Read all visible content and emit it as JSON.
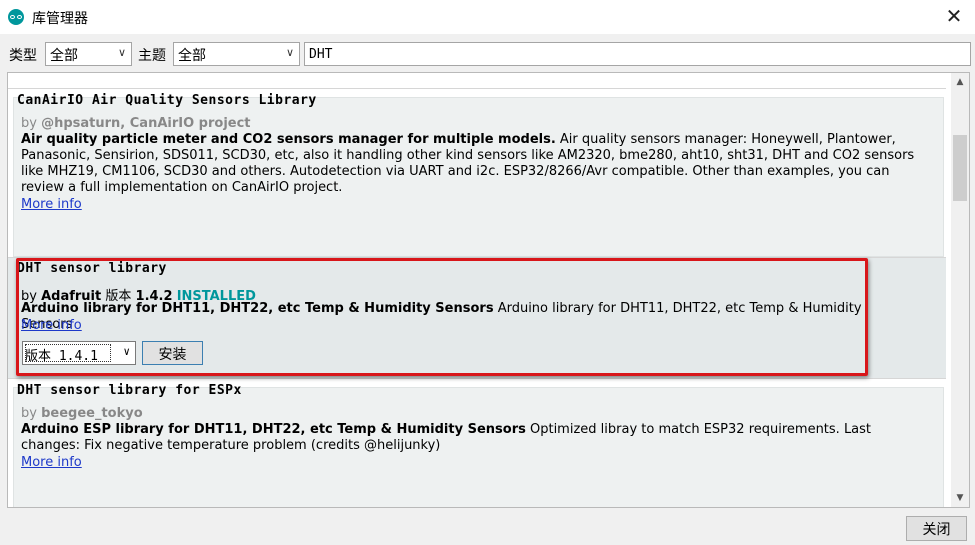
{
  "window": {
    "title": "库管理器",
    "close_glyph": "✕"
  },
  "filters": {
    "type_label": "类型",
    "type_value": "全部",
    "topic_label": "主题",
    "topic_value": "全部",
    "search_value": "DHT"
  },
  "libraries": [
    {
      "name": "CanAirIO Air Quality Sensors Library",
      "by_prefix": "by",
      "author": "@hpsaturn, CanAirIO project",
      "desc_bold": "Air quality particle meter and CO2 sensors manager for multiple models.",
      "desc": " Air quality sensors manager: Honeywell, Plantower, Panasonic, Sensirion, SDS011, SCD30, etc, also it handling other kind sensors like AM2320, bme280, aht10, sht31, DHT and CO2 sensors like MHZ19, CM1106, SCD30 and others. Autodetection via UART and i2c. ESP32/8266/Avr compatible. Other than examples, you can review a full implementation on CanAirIO project.",
      "more_info": "More info"
    },
    {
      "name": "DHT sensor library",
      "by_prefix": "by",
      "author": "Adafruit",
      "version_label": "版本",
      "version": "1.4.2",
      "status": "INSTALLED",
      "desc_bold": "Arduino library for DHT11, DHT22, etc Temp & Humidity Sensors",
      "desc": " Arduino library for DHT11, DHT22, etc Temp & Humidity Sensors",
      "more_info": "More info",
      "version_select": "版本 1.4.1",
      "install_button": "安装"
    },
    {
      "name": "DHT sensor library for ESPx",
      "by_prefix": "by",
      "author": "beegee_tokyo",
      "desc_bold": "Arduino ESP library for DHT11, DHT22, etc Temp & Humidity Sensors",
      "desc": " Optimized libray to match ESP32 requirements. Last changes: Fix negative temperature problem (credits @helijunky)",
      "more_info": "More info"
    }
  ],
  "footer": {
    "close_button": "关闭"
  },
  "colors": {
    "accent": "#00979c",
    "highlight": "#d8161a",
    "link": "#1d39c9"
  },
  "icons": {
    "app": "arduino-logo-icon",
    "dropdown": "chevron-down-icon",
    "scroll_up": "scroll-up-arrow-icon",
    "scroll_down": "scroll-down-arrow-icon"
  }
}
